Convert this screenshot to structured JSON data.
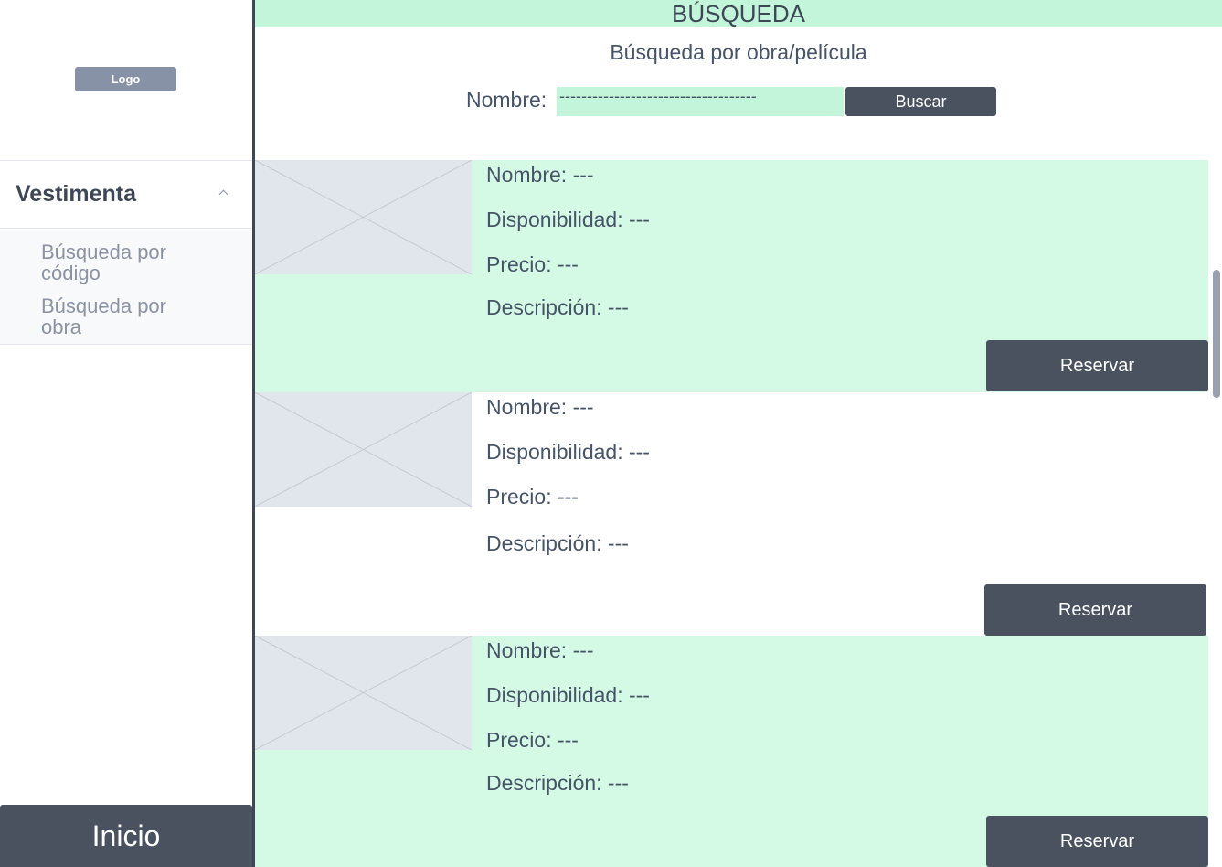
{
  "sidebar": {
    "logo_label": "Logo",
    "section_title": "Vestimenta",
    "items": [
      {
        "label": "Búsqueda por código"
      },
      {
        "label": "Búsqueda por obra"
      }
    ],
    "home_button": "Inicio"
  },
  "header": {
    "title": "BÚSQUEDA",
    "subtitle": "Búsqueda por obra/película"
  },
  "search": {
    "name_label": "Nombre:",
    "name_value": "------------------------------------",
    "button_label": "Buscar"
  },
  "results": [
    {
      "nombre": "Nombre: ---",
      "disponibilidad": "Disponibilidad: ---",
      "precio": "Precio: ---",
      "descripcion": "Descripción: ---",
      "button": "Reservar"
    },
    {
      "nombre": "Nombre: ---",
      "disponibilidad": "Disponibilidad: ---",
      "precio": "Precio: ---",
      "descripcion": "Descripción: ---",
      "button": "Reservar"
    },
    {
      "nombre": "Nombre: ---",
      "disponibilidad": "Disponibilidad: ---",
      "precio": "Precio: ---",
      "descripcion": "Descripción: ---",
      "button": "Reservar"
    }
  ],
  "colors": {
    "accent_green": "#c2f5d9",
    "card_green": "#d4fae6",
    "dark_button": "#4a5260",
    "logo_gray": "#8892a6"
  }
}
